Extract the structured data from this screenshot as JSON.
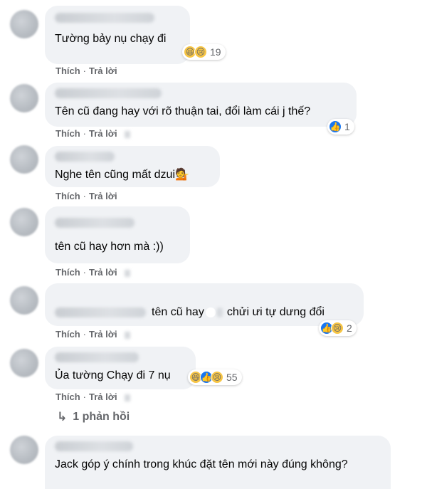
{
  "action_like": "Thích",
  "action_reply": "Trả lời",
  "action_sep": "·",
  "comments": [
    {
      "text": "Tường bảy nụ chạy đi",
      "reactions": [
        "haha-icon",
        "sad-icon"
      ],
      "count": "19"
    },
    {
      "text": "Tên cũ đang hay với rõ thuận tai, đổi làm cái j thế?",
      "reactions": [
        "like-icon"
      ],
      "count": "1"
    },
    {
      "text": "Nghe tên cũng mất dzui",
      "emoji": "💁"
    },
    {
      "text": "tên cũ hay hơn mà :))"
    },
    {
      "text_a": "tên cũ hay",
      "text_b": "chửi ưi tự dưng đổi",
      "reactions": [
        "like-icon",
        "sad-icon"
      ],
      "count": "2"
    },
    {
      "text": "Ủa tường Chạy đi 7 nụ",
      "reactions": [
        "haha-icon",
        "like-icon",
        "sad-icon"
      ],
      "count": "55"
    },
    {
      "text": "Jack góp ý chính trong khúc đặt tên mới này đúng không?"
    }
  ],
  "replies": {
    "label": "1 phản hồi",
    "icon": "reply-arrow-icon",
    "glyph": "↳"
  },
  "colors": {
    "bubble": "#f0f2f5",
    "secondary_text": "#65676b",
    "like_blue": "#1877f2",
    "emoji_yellow": "#f7c544"
  }
}
